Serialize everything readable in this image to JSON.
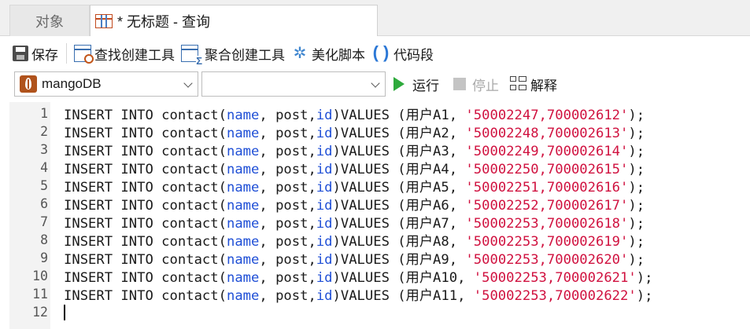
{
  "tabs": {
    "objects_label": "对象",
    "query_label": "* 无标题 - 查询"
  },
  "toolbar": {
    "save_label": "保存",
    "find_builder_label": "查找创建工具",
    "aggregate_builder_label": "聚合创建工具",
    "beautify_label": "美化脚本",
    "snippet_label": "代码段"
  },
  "connection": {
    "selected_connection": "mangoDB",
    "selected_database": "",
    "run_label": "运行",
    "stop_label": "停止",
    "explain_label": "解释"
  },
  "editor": {
    "lines": [
      {
        "num": "1",
        "p1": "INSERT INTO contact(",
        "c1": "name",
        "p2": ", post,",
        "c2": "id",
        "p3": ")VALUES (用户A1, ",
        "s": "'50002247,700002612'",
        "p4": ");"
      },
      {
        "num": "2",
        "p1": "INSERT INTO contact(",
        "c1": "name",
        "p2": ", post,",
        "c2": "id",
        "p3": ")VALUES (用户A2, ",
        "s": "'50002248,700002613'",
        "p4": ");"
      },
      {
        "num": "3",
        "p1": "INSERT INTO contact(",
        "c1": "name",
        "p2": ", post,",
        "c2": "id",
        "p3": ")VALUES (用户A3, ",
        "s": "'50002249,700002614'",
        "p4": ");"
      },
      {
        "num": "4",
        "p1": "INSERT INTO contact(",
        "c1": "name",
        "p2": ", post,",
        "c2": "id",
        "p3": ")VALUES (用户A4, ",
        "s": "'50002250,700002615'",
        "p4": ");"
      },
      {
        "num": "5",
        "p1": "INSERT INTO contact(",
        "c1": "name",
        "p2": ", post,",
        "c2": "id",
        "p3": ")VALUES (用户A5, ",
        "s": "'50002251,700002616'",
        "p4": ");"
      },
      {
        "num": "6",
        "p1": "INSERT INTO contact(",
        "c1": "name",
        "p2": ", post,",
        "c2": "id",
        "p3": ")VALUES (用户A6, ",
        "s": "'50002252,700002617'",
        "p4": ");"
      },
      {
        "num": "7",
        "p1": "INSERT INTO contact(",
        "c1": "name",
        "p2": ", post,",
        "c2": "id",
        "p3": ")VALUES (用户A7, ",
        "s": "'50002253,700002618'",
        "p4": ");"
      },
      {
        "num": "8",
        "p1": "INSERT INTO contact(",
        "c1": "name",
        "p2": ", post,",
        "c2": "id",
        "p3": ")VALUES (用户A8, ",
        "s": "'50002253,700002619'",
        "p4": ");"
      },
      {
        "num": "9",
        "p1": "INSERT INTO contact(",
        "c1": "name",
        "p2": ", post,",
        "c2": "id",
        "p3": ")VALUES (用户A9, ",
        "s": "'50002253,700002620'",
        "p4": ");"
      },
      {
        "num": "10",
        "p1": "INSERT INTO contact(",
        "c1": "name",
        "p2": ", post,",
        "c2": "id",
        "p3": ")VALUES (用户A10, ",
        "s": "'50002253,700002621'",
        "p4": ");"
      },
      {
        "num": "11",
        "p1": "INSERT INTO contact(",
        "c1": "name",
        "p2": ", post,",
        "c2": "id",
        "p3": ")VALUES (用户A11, ",
        "s": "'50002253,700002622'",
        "p4": ");"
      },
      {
        "num": "12",
        "p1": "",
        "c1": "",
        "p2": "",
        "c2": "",
        "p3": "",
        "s": "",
        "p4": ""
      }
    ]
  },
  "colors": {
    "keyword_column": "#1f4fd6",
    "string_literal": "#d0113f",
    "run_green": "#2eaa3c",
    "mongo_brand": "#b0531c"
  },
  "icons": [
    "table-query-icon",
    "save-icon",
    "find-builder-icon",
    "aggregate-builder-icon",
    "beautify-icon",
    "snippet-icon",
    "mongodb-icon",
    "chevron-down-icon",
    "run-icon",
    "stop-icon",
    "explain-icon"
  ]
}
